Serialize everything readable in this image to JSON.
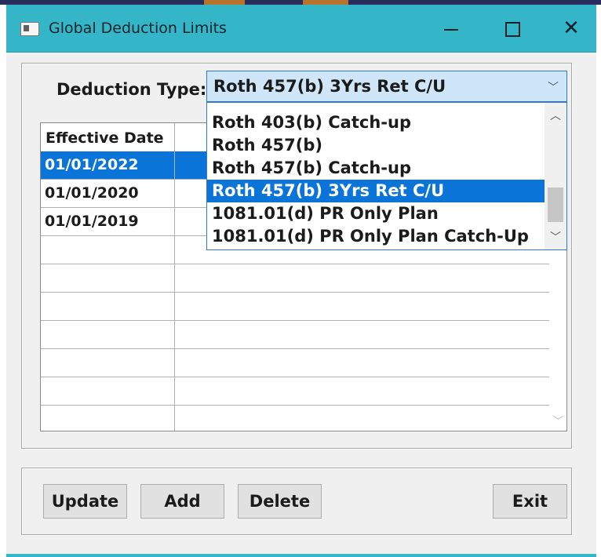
{
  "window": {
    "title": "Global Deduction Limits"
  },
  "deduction_type": {
    "label": "Deduction Type:",
    "selected_value": "Roth 457(b) 3Yrs Ret C/U"
  },
  "dropdown": {
    "options": [
      "Roth 403(b) Catch-up",
      "Roth 457(b)",
      "Roth 457(b) Catch-up",
      "Roth 457(b) 3Yrs Ret C/U",
      "1081.01(d) PR Only Plan",
      "1081.01(d) PR Only Plan Catch-Up"
    ],
    "highlighted": "Roth 457(b) 3Yrs Ret C/U"
  },
  "grid": {
    "header": "Effective Date",
    "rows": [
      "01/01/2022",
      "01/01/2020",
      "01/01/2019",
      "",
      "",
      "",
      "",
      "",
      "",
      ""
    ],
    "selected_row": "01/01/2022"
  },
  "buttons": {
    "update": "Update",
    "add": "Add",
    "delete": "Delete",
    "exit": "Exit"
  },
  "icons": {
    "app": "app-window-icon",
    "minimize": "minimize-icon",
    "maximize": "maximize-icon",
    "close": "close-icon",
    "combo_arrow": "chevron-down-icon",
    "scroll_up": "chevron-up-icon",
    "scroll_down": "chevron-down-icon"
  },
  "colors": {
    "titlebar": "#35b6c8",
    "selection": "#0a74d9",
    "combo_focus": "#cfe6f8"
  }
}
